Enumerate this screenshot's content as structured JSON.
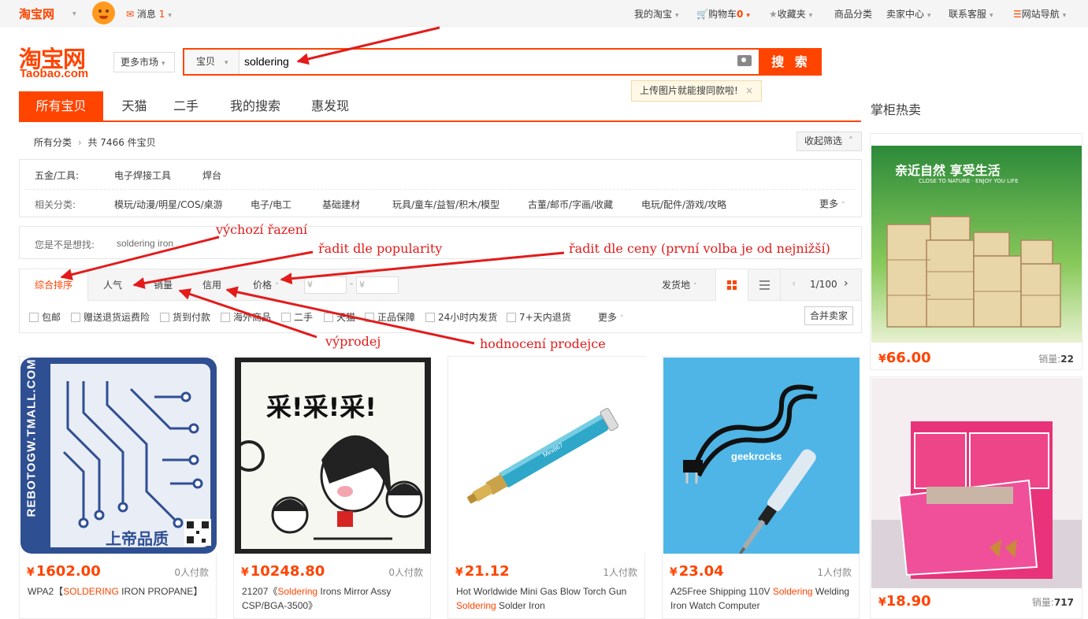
{
  "topbar": {
    "logo": "淘宝网",
    "messages_label": "消息",
    "messages_count": "1",
    "my_taobao": "我的淘宝",
    "cart_label": "购物车",
    "cart_count": "0",
    "favorites": "收藏夹",
    "categories": "商品分类",
    "seller_center": "卖家中心",
    "customer_service": "联系客服",
    "site_nav": "网站导航"
  },
  "header": {
    "logo_cn": "淘宝网",
    "logo_en": "Taobao.com",
    "more_markets": "更多市场",
    "search_scope": "宝贝",
    "search_query": "soldering",
    "search_button": "搜 索",
    "image_tip": "上传图片就能搜同款啦!",
    "tip_close": "×"
  },
  "nav": {
    "tabs": [
      "所有宝贝",
      "天猫",
      "二手",
      "我的搜索",
      "惠发现"
    ],
    "right_title": "掌柜热卖"
  },
  "breadcrumb": {
    "root": "所有分类",
    "count_text": "共 7466 件宝贝",
    "collapse": "收起筛选"
  },
  "category": {
    "label1": "五金/工具:",
    "items1": [
      "电子焊接工具",
      "焊台"
    ],
    "label2": "相关分类:",
    "items2": [
      "模玩/动漫/明星/COS/桌游",
      "电子/电工",
      "基础建材",
      "玩具/童车/益智/积木/模型",
      "古董/邮币/字画/收藏",
      "电玩/配件/游戏/攻略"
    ],
    "more": "更多"
  },
  "suggest": {
    "label": "您是不是想找:",
    "item": "soldering iron"
  },
  "sort": {
    "options": [
      "综合排序",
      "人气",
      "销量",
      "信用",
      "价格"
    ],
    "price_from": "¥",
    "price_to": "¥",
    "ship_from": "发货地",
    "page": "1/100",
    "filters": [
      "包邮",
      "赠送退货运费险",
      "货到付款",
      "海外商品",
      "二手",
      "天猫",
      "正品保障",
      "24小时内发货",
      "7+天内退货"
    ],
    "more": "更多",
    "merge": "合并卖家"
  },
  "products": [
    {
      "price": "1602.00",
      "deals": "0人付款",
      "title_pre": "WPA2【",
      "title_hl": "SOLDERING",
      "title_post": " IRON PROPANE】"
    },
    {
      "price": "10248.80",
      "deals": "0人付款",
      "title_pre": "21207《",
      "title_hl": "Soldering",
      "title_post": " Irons Mirror Assy CSP/BGA-3500》"
    },
    {
      "price": "21.12",
      "deals": "1人付款",
      "title_pre": "Hot Worldwide Mini Gas Blow Torch Gun ",
      "title_hl": "Soldering",
      "title_post": " Solder Iron"
    },
    {
      "price": "23.04",
      "deals": "1人付款",
      "title_pre": "A25Free Shipping 110V ",
      "title_hl": "Soldering",
      "title_post": " Welding Iron Watch Computer"
    }
  ],
  "product_image_text": {
    "p1_vertical": "REBOTOGW.TMALL.COM",
    "p1_brand": "上帝品质",
    "p2_caption": "采!采!采!",
    "p3_label": "Mini867",
    "p4_watermark": "geekrocks"
  },
  "right_ads": [
    {
      "price": "66.00",
      "sales_label": "销量:",
      "sales": "22",
      "banner": "亲近自然 享受生活",
      "banner_sub": "CLOSE TO NATURE · ENJOY YOU LIFE"
    },
    {
      "price": "18.90",
      "sales_label": "销量:",
      "sales": "717"
    }
  ],
  "currency": "¥",
  "annotations": {
    "default_sort": "výchozí řazení",
    "popularity": "řadit dle popularity",
    "price": "řadit dle ceny (první volba je od nejnižší)",
    "sales": "výprodej",
    "seller_rating": "hodnocení prodejce"
  },
  "colors": {
    "accent": "#ff4400",
    "annotation": "#e31b1b"
  }
}
